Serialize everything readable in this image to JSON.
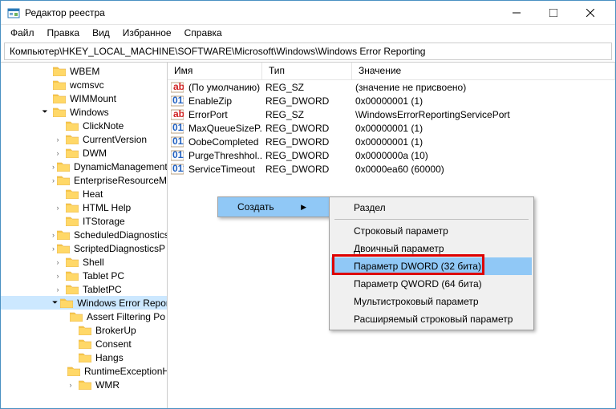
{
  "window": {
    "title": "Редактор реестра"
  },
  "menu": [
    "Файл",
    "Правка",
    "Вид",
    "Избранное",
    "Справка"
  ],
  "address": "Компьютер\\HKEY_LOCAL_MACHINE\\SOFTWARE\\Microsoft\\Windows\\Windows Error Reporting",
  "tree": [
    {
      "d": 3,
      "a": "",
      "l": "WBEM"
    },
    {
      "d": 3,
      "a": "",
      "l": "wcmsvc"
    },
    {
      "d": 3,
      "a": "",
      "l": "WIMMount"
    },
    {
      "d": 3,
      "a": "v",
      "l": "Windows"
    },
    {
      "d": 4,
      "a": "",
      "l": "ClickNote"
    },
    {
      "d": 4,
      "a": ">",
      "l": "CurrentVersion"
    },
    {
      "d": 4,
      "a": ">",
      "l": "DWM"
    },
    {
      "d": 4,
      "a": ">",
      "l": "DynamicManagement"
    },
    {
      "d": 4,
      "a": ">",
      "l": "EnterpriseResourceM"
    },
    {
      "d": 4,
      "a": "",
      "l": "Heat"
    },
    {
      "d": 4,
      "a": ">",
      "l": "HTML Help"
    },
    {
      "d": 4,
      "a": "",
      "l": "ITStorage"
    },
    {
      "d": 4,
      "a": ">",
      "l": "ScheduledDiagnosticsP"
    },
    {
      "d": 4,
      "a": ">",
      "l": "ScriptedDiagnosticsP"
    },
    {
      "d": 4,
      "a": ">",
      "l": "Shell"
    },
    {
      "d": 4,
      "a": ">",
      "l": "Tablet PC"
    },
    {
      "d": 4,
      "a": ">",
      "l": "TabletPC"
    },
    {
      "d": 4,
      "a": "v",
      "l": "Windows Error Reporting",
      "sel": true
    },
    {
      "d": 5,
      "a": "",
      "l": "Assert Filtering Po"
    },
    {
      "d": 5,
      "a": "",
      "l": "BrokerUp"
    },
    {
      "d": 5,
      "a": "",
      "l": "Consent"
    },
    {
      "d": 5,
      "a": "",
      "l": "Hangs"
    },
    {
      "d": 5,
      "a": "",
      "l": "RuntimeExceptionH"
    },
    {
      "d": 5,
      "a": ">",
      "l": "WMR"
    }
  ],
  "cols": [
    "Имя",
    "Тип",
    "Значение"
  ],
  "rows": [
    {
      "ic": "sz",
      "n": "(По умолчанию)",
      "t": "REG_SZ",
      "v": "(значение не присвоено)"
    },
    {
      "ic": "dw",
      "n": "EnableZip",
      "t": "REG_DWORD",
      "v": "0x00000001 (1)"
    },
    {
      "ic": "sz",
      "n": "ErrorPort",
      "t": "REG_SZ",
      "v": "\\WindowsErrorReportingServicePort"
    },
    {
      "ic": "dw",
      "n": "MaxQueueSizeP...",
      "t": "REG_DWORD",
      "v": "0x00000001 (1)"
    },
    {
      "ic": "dw",
      "n": "OobeCompleted",
      "t": "REG_DWORD",
      "v": "0x00000001 (1)"
    },
    {
      "ic": "dw",
      "n": "PurgeThreshhol...",
      "t": "REG_DWORD",
      "v": "0x0000000a (10)"
    },
    {
      "ic": "dw",
      "n": "ServiceTimeout",
      "t": "REG_DWORD",
      "v": "0x0000ea60 (60000)"
    }
  ],
  "ctx1": {
    "label": "Создать",
    "arrow": "▶"
  },
  "ctx2": [
    {
      "l": "Раздел"
    },
    {
      "sep": true
    },
    {
      "l": "Строковый параметр"
    },
    {
      "l": "Двоичный параметр"
    },
    {
      "l": "Параметр DWORD (32 бита)",
      "hl": true
    },
    {
      "l": "Параметр QWORD (64 бита)"
    },
    {
      "l": "Мультистроковый параметр"
    },
    {
      "l": "Расширяемый строковый параметр"
    }
  ]
}
